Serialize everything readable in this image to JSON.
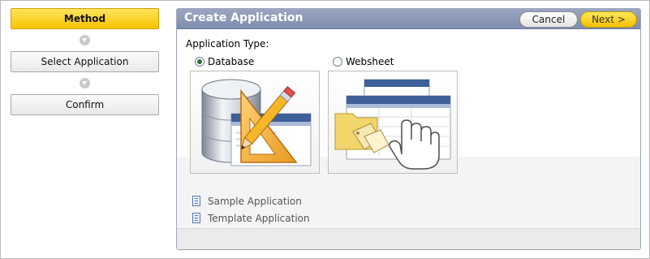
{
  "wizard": {
    "steps": [
      {
        "label": "Method",
        "active": true
      },
      {
        "label": "Select Application",
        "active": false
      },
      {
        "label": "Confirm",
        "active": false
      }
    ]
  },
  "region": {
    "title": "Create Application",
    "cancel_label": "Cancel",
    "next_label": "Next >"
  },
  "form": {
    "app_type_label": "Application Type:",
    "options": [
      {
        "label": "Database",
        "selected": true,
        "icon": "database-icon"
      },
      {
        "label": "Websheet",
        "selected": false,
        "icon": "websheet-icon"
      }
    ]
  },
  "links": [
    {
      "label": "Sample Application",
      "icon": "document-icon"
    },
    {
      "label": "Template Application",
      "icon": "document-icon"
    }
  ],
  "colors": {
    "active_step": "#f8c300",
    "header_blue": "#8997b7",
    "next_button": "#f4c100"
  }
}
